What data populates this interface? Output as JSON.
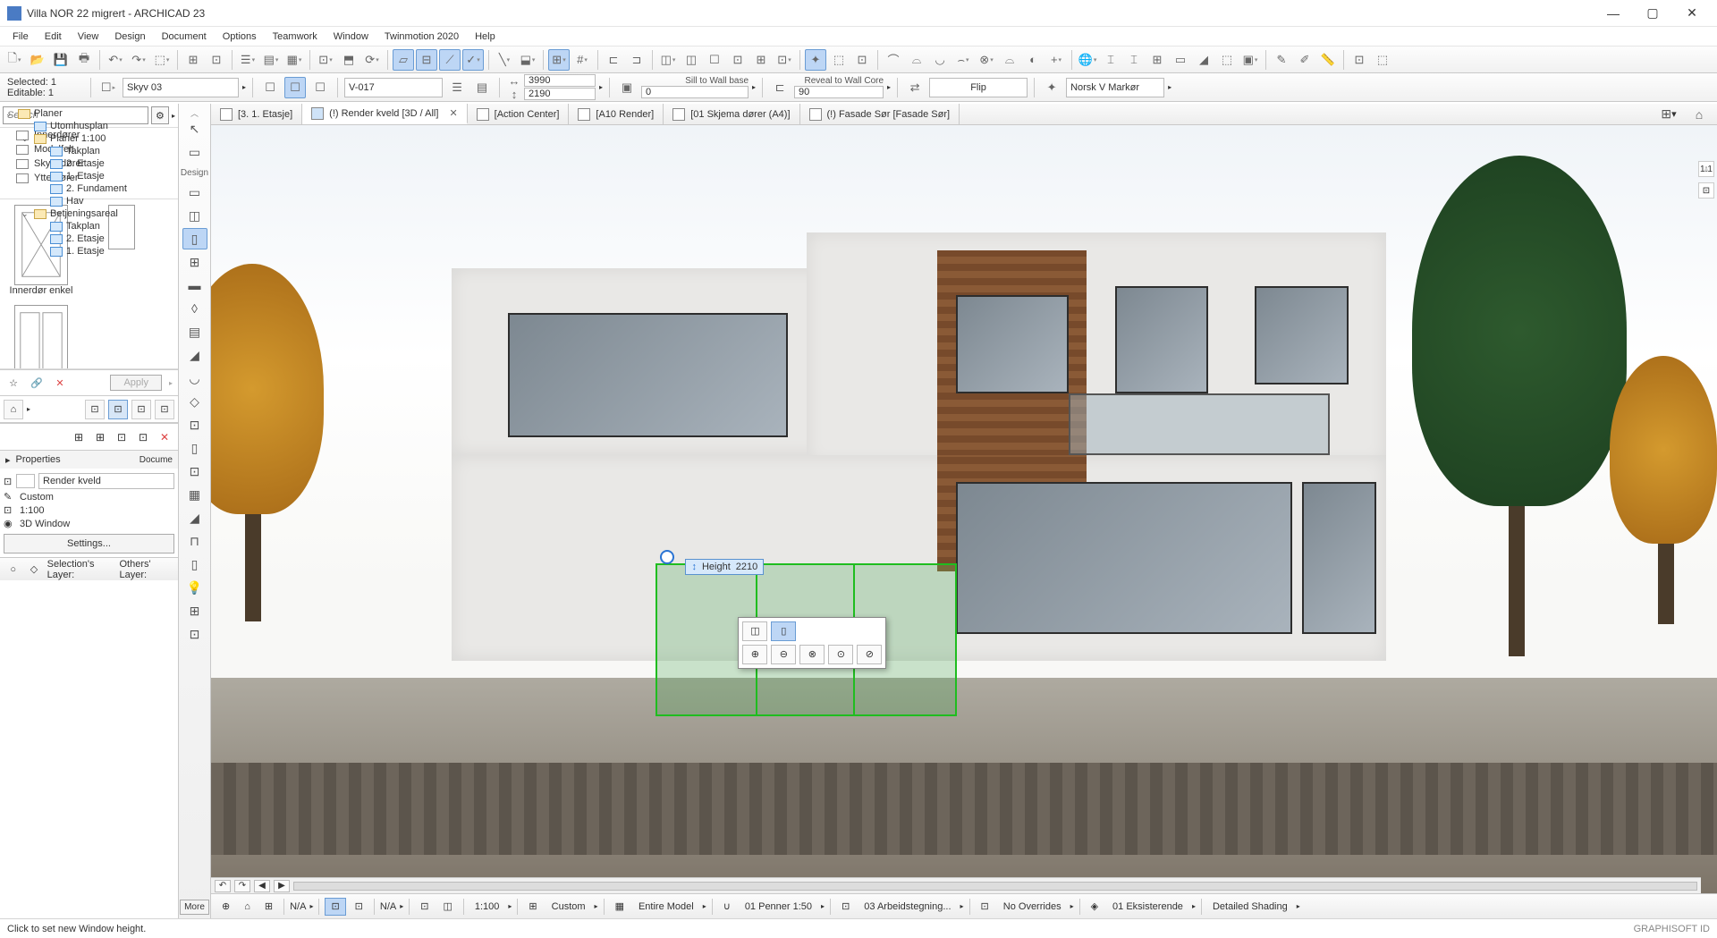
{
  "app": {
    "title": "Villa NOR 22 migrert - ARCHICAD 23"
  },
  "menu": [
    "File",
    "Edit",
    "View",
    "Design",
    "Document",
    "Options",
    "Teamwork",
    "Window",
    "Twinmotion 2020",
    "Help"
  ],
  "info": {
    "selected": "Selected: 1",
    "editable": "Editable: 1",
    "layer": "Skyv 03",
    "vcode": "V-017",
    "dim1": "3990",
    "dim2": "2190",
    "zero": "0",
    "sill": "Sill to Wall base",
    "reveal": "Reveal to Wall Core",
    "ninety": "90",
    "flip": "Flip",
    "marker": "Norsk V Markør"
  },
  "search_placeholder": "Search",
  "folders": [
    "Innerdører",
    "Modulfelt",
    "Skyvedører",
    "Ytterdører"
  ],
  "thumb_label": "Innerdør enkel",
  "apply": "Apply",
  "tree": {
    "root": "Planer",
    "items": [
      "Utomhusplan",
      "Planer 1:100",
      "Takplan",
      "2. Etasje",
      "1. Etasje",
      "2. Fundament",
      "Hav",
      "Betjeningsareal",
      "Takplan",
      "2. Etasje",
      "1. Etasje"
    ]
  },
  "props": {
    "header": "Properties",
    "name": "Render kveld",
    "r1": "Custom",
    "r2": "1:100",
    "r3": "3D Window",
    "settings": "Settings..."
  },
  "scale_label": "Docume",
  "layers": {
    "sel": "Selection's Layer:",
    "oth": "Others' Layer:"
  },
  "design_label": "Design",
  "more": "More",
  "tabs": [
    {
      "label": "[3. 1. Etasje]"
    },
    {
      "label": "(!) Render kveld [3D / All]",
      "active": true,
      "closable": true
    },
    {
      "label": "[Action Center]"
    },
    {
      "label": "[A10 Render]"
    },
    {
      "label": "[01 Skjema dører (A4)]"
    },
    {
      "label": "(!) Fasade Sør [Fasade Sør]"
    }
  ],
  "height_label": "Height",
  "height_value": "2210",
  "qbar": {
    "na1": "N/A",
    "na2": "N/A",
    "scale": "1:100",
    "custom": "Custom",
    "model": "Entire Model",
    "penset": "01 Penner 1:50",
    "layerc": "03 Arbeidstegning...",
    "over": "No Overrides",
    "reno": "01 Eksisterende",
    "shade": "Detailed Shading"
  },
  "status": {
    "msg": "Click to set new Window height.",
    "id": "GRAPHISOFT ID"
  }
}
